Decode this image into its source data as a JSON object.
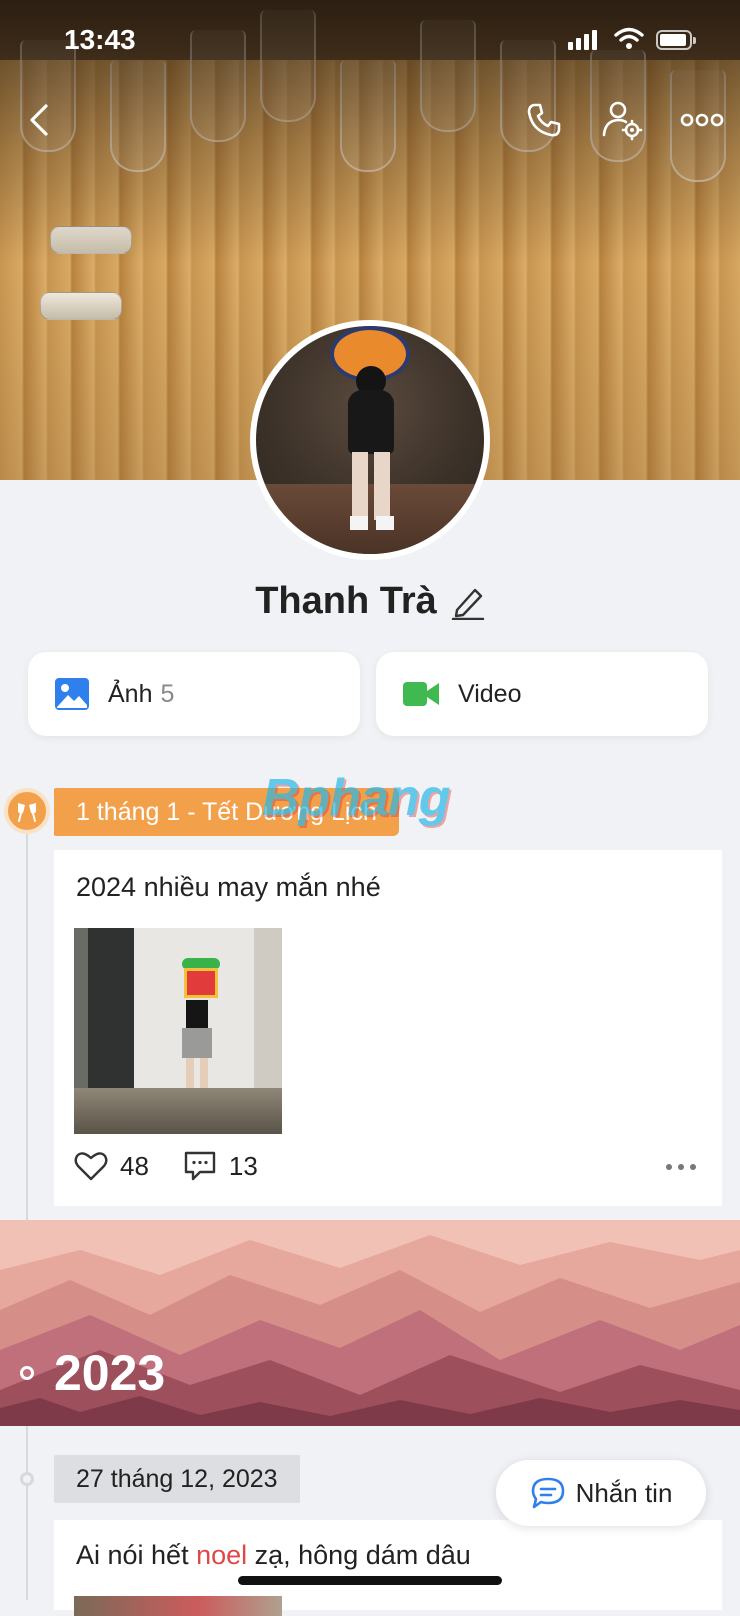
{
  "status_bar": {
    "time": "13:43"
  },
  "profile": {
    "name": "Thanh Trà"
  },
  "media": {
    "photos_label": "Ảnh",
    "photos_count": "5",
    "video_label": "Video"
  },
  "timeline": {
    "event_label": "1 tháng 1 - Tết Dương Lịch",
    "watermark": "Bphang",
    "post": {
      "text": "2024 nhiều may mắn nhé",
      "likes": "48",
      "comments": "13"
    },
    "year": "2023",
    "date_label": "27 tháng 12, 2023",
    "post2": {
      "text_before": "Ai nói hết ",
      "text_highlight": "noel",
      "text_after": " zạ, hông dám dâu"
    }
  },
  "message_button": {
    "label": "Nhắn tin"
  },
  "colors": {
    "accent_orange": "#f3a04a",
    "highlight_red": "#e04848",
    "photo_blue": "#2f80ed",
    "video_green": "#3fb950",
    "chat_blue": "#2f80ed"
  },
  "icons": {
    "back": "back-icon",
    "call": "phone-icon",
    "settings": "user-settings-icon",
    "more": "more-icon",
    "edit": "pencil-icon",
    "photos": "image-icon",
    "video": "video-camera-icon",
    "event": "cheers-icon",
    "like": "heart-icon",
    "comment": "comment-icon",
    "message": "chat-bubble-icon"
  }
}
